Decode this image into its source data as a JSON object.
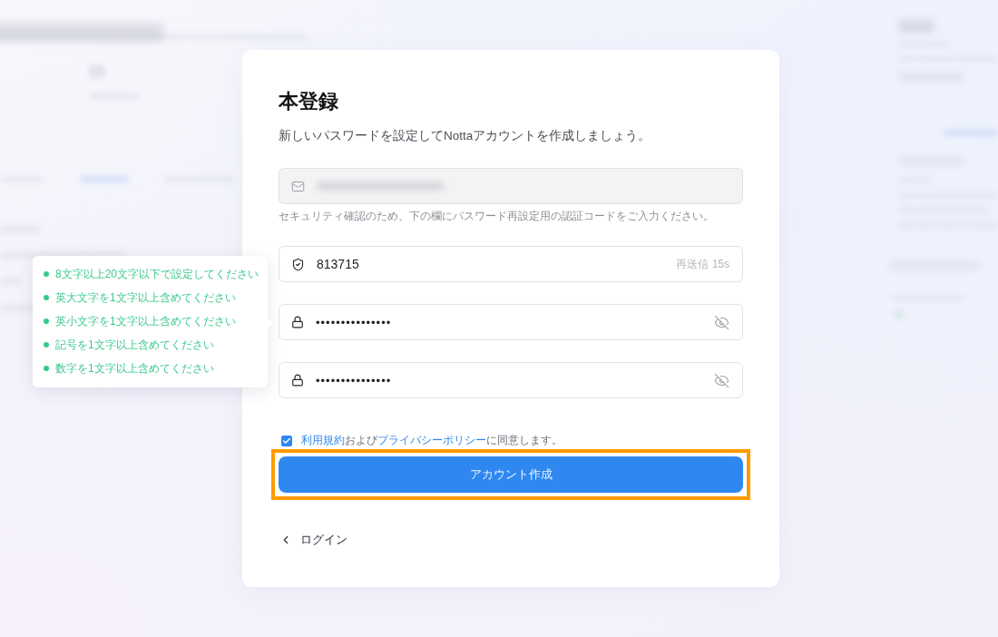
{
  "dialog": {
    "title": "本登録",
    "subtitle": "新しいパスワードを設定してNottaアカウントを作成しましょう。"
  },
  "fields": [
    {
      "kind": "email",
      "redacted": true,
      "disabled": true,
      "note": "セキュリティ確認のため、下の欄にパスワード再設定用の認証コードをご入力ください。"
    },
    {
      "kind": "code",
      "value": "813715",
      "resend": {
        "label": "再送信 15s",
        "disabled": true
      }
    },
    {
      "kind": "password",
      "value": "•••••••••••••••",
      "visible": false
    },
    {
      "kind": "password",
      "value": "•••••••••••••••",
      "visible": false
    }
  ],
  "password_rules": [
    {
      "text": "8文字以上20文字以下で設定してください",
      "met": true
    },
    {
      "text": "英大文字を1文字以上含めてください",
      "met": true
    },
    {
      "text": "英小文字を1文字以上含めてください",
      "met": true
    },
    {
      "text": "記号を1文字以上含めてください",
      "met": true
    },
    {
      "text": "数字を1文字以上含めてください",
      "met": true
    }
  ],
  "terms": {
    "checked": true,
    "parts": [
      {
        "kind": "link",
        "text": "利用規約"
      },
      {
        "kind": "text",
        "text": "および"
      },
      {
        "kind": "link",
        "text": "プライバシーポリシー"
      },
      {
        "kind": "text",
        "text": "に同意します。"
      }
    ]
  },
  "create_button": {
    "label": "アカウント作成",
    "highlighted": true
  },
  "back_link": {
    "label": "ログイン"
  }
}
